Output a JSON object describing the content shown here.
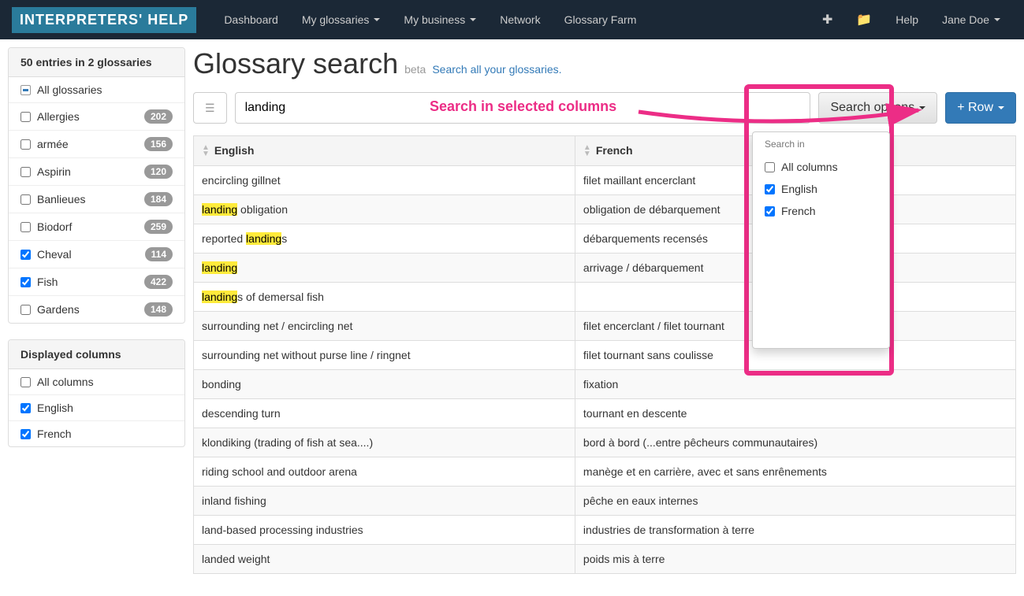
{
  "brand": "INTERPRETERS' HELP",
  "nav": {
    "dashboard": "Dashboard",
    "my_glossaries": "My glossaries",
    "my_business": "My business",
    "network": "Network",
    "glossary_farm": "Glossary Farm",
    "help": "Help",
    "user": "Jane Doe"
  },
  "sidebar": {
    "entries_heading": "50 entries in 2 glossaries",
    "all_glossaries": "All glossaries",
    "glossaries": [
      {
        "name": "Allergies",
        "count": "202",
        "checked": false
      },
      {
        "name": "armée",
        "count": "156",
        "checked": false
      },
      {
        "name": "Aspirin",
        "count": "120",
        "checked": false
      },
      {
        "name": "Banlieues",
        "count": "184",
        "checked": false
      },
      {
        "name": "Biodorf",
        "count": "259",
        "checked": false
      },
      {
        "name": "Cheval",
        "count": "114",
        "checked": true
      },
      {
        "name": "Fish",
        "count": "422",
        "checked": true
      },
      {
        "name": "Gardens",
        "count": "148",
        "checked": false
      }
    ],
    "columns_heading": "Displayed columns",
    "all_columns": "All columns",
    "columns": [
      {
        "name": "English",
        "checked": true
      },
      {
        "name": "French",
        "checked": true
      }
    ]
  },
  "page": {
    "title": "Glossary search",
    "beta": "beta",
    "subtitle": "Search all your glossaries."
  },
  "search": {
    "value": "landing",
    "options_label": "Search options",
    "add_row": "+ Row",
    "callout": "Search in selected columns",
    "dropdown_header": "Search in",
    "dd_all": "All columns",
    "dd_items": [
      {
        "name": "English",
        "checked": true
      },
      {
        "name": "French",
        "checked": true
      }
    ]
  },
  "table": {
    "headers": {
      "en": "English",
      "fr": "French"
    },
    "rows": [
      {
        "en": "encircling gillnet",
        "fr": "filet maillant encerclant"
      },
      {
        "en": "<mark>landing</mark> obligation",
        "fr": "obligation de débarquement"
      },
      {
        "en": "reported <mark>landing</mark>s",
        "fr": "débarquements recensés"
      },
      {
        "en": "<mark>landing</mark>",
        "fr": "arrivage / débarquement"
      },
      {
        "en": "<mark>landing</mark>s of demersal fish",
        "fr": ""
      },
      {
        "en": "surrounding net / encircling net",
        "fr": "filet encerclant / filet tournant"
      },
      {
        "en": "surrounding net without purse line / ringnet",
        "fr": "filet tournant sans coulisse"
      },
      {
        "en": "bonding",
        "fr": "fixation"
      },
      {
        "en": "descending turn",
        "fr": "tournant en descente"
      },
      {
        "en": "klondiking (trading of fish at sea....)",
        "fr": "bord à bord (...entre pêcheurs communautaires)"
      },
      {
        "en": "riding school and outdoor arena",
        "fr": "manège et en carrière, avec et sans enrênements"
      },
      {
        "en": "inland fishing",
        "fr": "pêche en eaux internes"
      },
      {
        "en": "land-based processing industries",
        "fr": "industries de transformation à terre"
      },
      {
        "en": "landed weight",
        "fr": "poids mis à terre"
      }
    ]
  }
}
